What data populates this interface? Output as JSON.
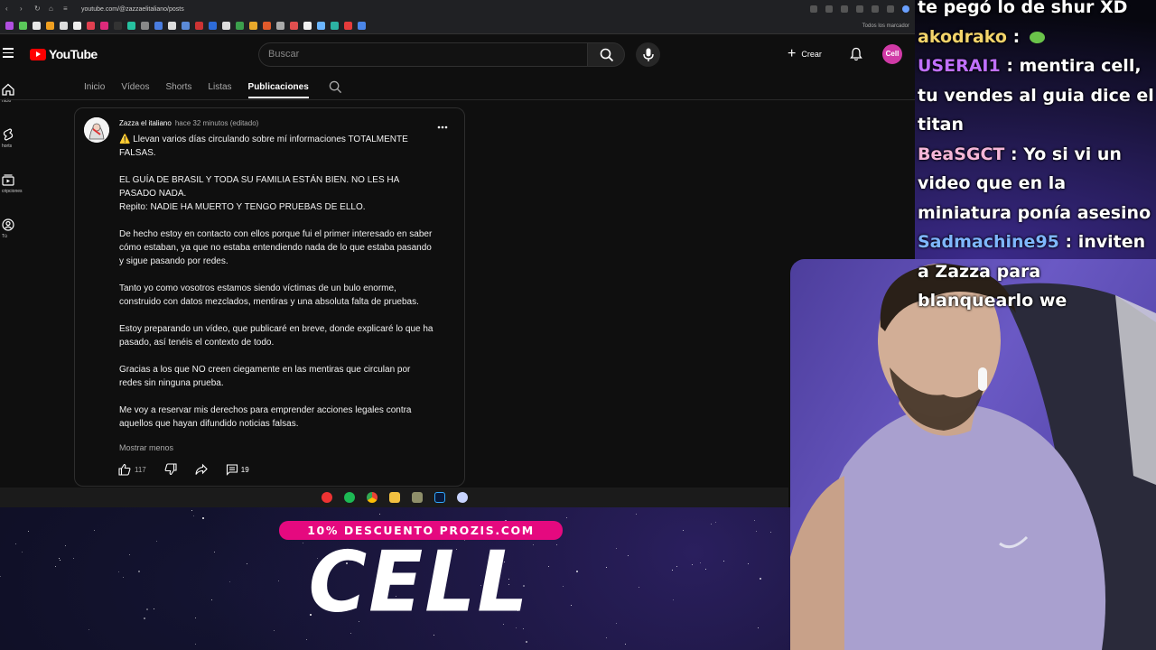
{
  "browser": {
    "url": "youtube.com/@zazzaelitaliano/posts",
    "bookmarks_label": "Todos los marcador"
  },
  "header": {
    "logo_text": "YouTube",
    "search_placeholder": "Buscar",
    "create_label": "Crear",
    "avatar_text": "Cell"
  },
  "sidebar": {
    "items": [
      {
        "label": "nicio",
        "icon": "home-icon"
      },
      {
        "label": "horts",
        "icon": "shorts-icon"
      },
      {
        "label": "cripciones",
        "icon": "subscriptions-icon"
      },
      {
        "label": "Tú",
        "icon": "you-icon"
      }
    ]
  },
  "tabs": [
    {
      "label": "Inicio"
    },
    {
      "label": "Vídeos"
    },
    {
      "label": "Shorts"
    },
    {
      "label": "Listas"
    },
    {
      "label": "Publicaciones",
      "active": true
    }
  ],
  "post": {
    "author": "Zazza el italiano",
    "time": "hace 32 minutos (editado)",
    "paragraphs": [
      "⚠️ Llevan varios días circulando sobre mí informaciones TOTALMENTE FALSAS.",
      "EL GUÍA DE BRASIL Y TODA SU FAMILIA ESTÁN BIEN. NO LES HA PASADO NADA.",
      "Repito: NADIE HA MUERTO Y TENGO PRUEBAS DE ELLO.",
      "De hecho estoy en contacto con ellos porque fui el primer interesado en saber cómo estaban, ya que no estaba entendiendo nada de lo que estaba pasando y sigue pasando por redes.",
      "Tanto yo como vosotros estamos siendo víctimas de un bulo enorme, construido con datos mezclados, mentiras y una absoluta falta de pruebas.",
      "Estoy preparando un vídeo, que publicaré en breve, donde explicaré lo que ha pasado, así tenéis el contexto de todo.",
      "Gracias a los que NO creen ciegamente en las mentiras que circulan por redes sin ninguna prueba.",
      "Me voy a reservar mis derechos para emprender acciones legales contra aquellos que hayan difundido noticias falsas."
    ],
    "show_less": "Mostrar menos",
    "likes": "117",
    "comments": "19"
  },
  "promo": {
    "banner": "10% DESCUENTO PROZIS.COM",
    "logo": "CELL"
  },
  "chat": {
    "top_partial": "te pegó lo de shur XD",
    "messages": [
      {
        "user": "akodrako",
        "user_color": "#f3d46b",
        "text": " : "
      },
      {
        "user": "USERAI1",
        "user_color": "#c070ff",
        "text": " : mentira cell, tu vendes al guia dice el titan"
      },
      {
        "user": "BeaSGCT",
        "user_color": "#f5b6d8",
        "text": " : Yo si vi un video que en la miniatura ponía asesino"
      },
      {
        "user": "Sadmachine95",
        "user_color": "#7fb7ff",
        "text": " : inviten a Zazza para blanquearlo we"
      }
    ]
  },
  "colors": {
    "yt_red": "#ff0000",
    "promo_pink": "#e5097f",
    "bg_dark": "#0f0f0f"
  }
}
